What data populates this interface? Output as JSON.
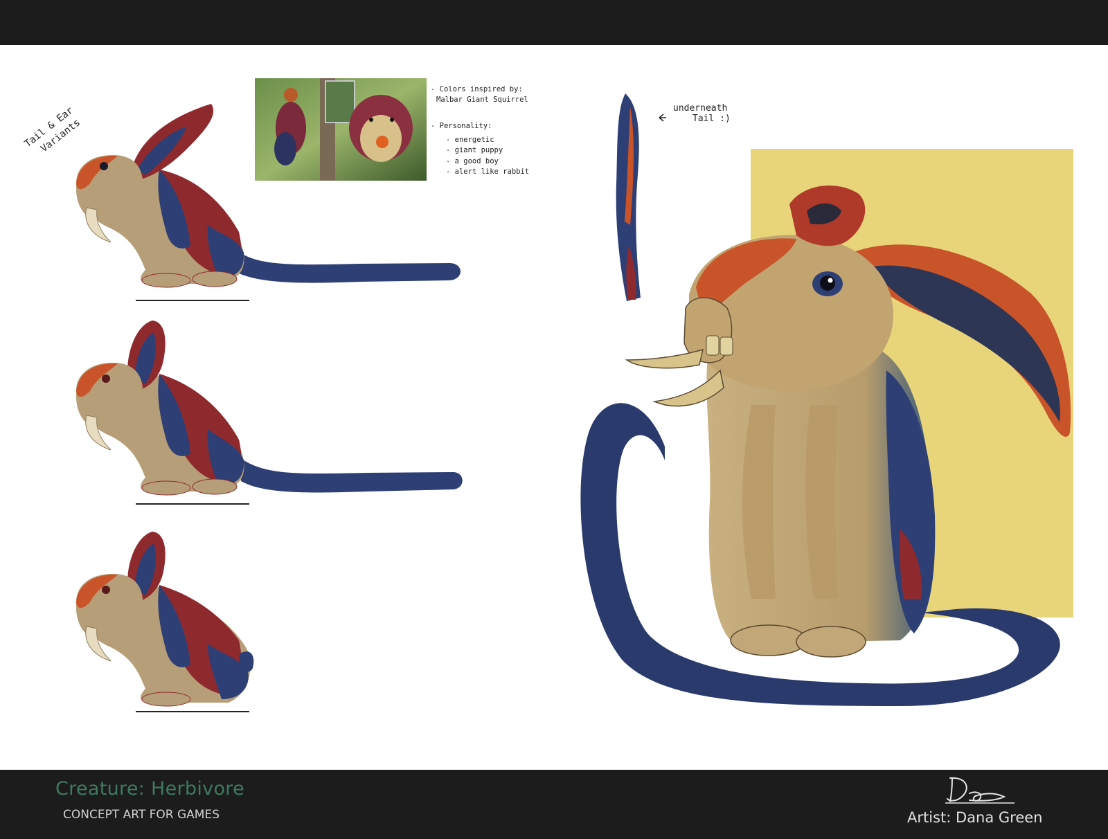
{
  "project": {
    "title": "Creature: Herbivore",
    "subtitle": "CONCEPT ART FOR GAMES",
    "artist_credit": "Artist: Dana Green",
    "signature_text": "DG"
  },
  "variants": {
    "label_line1": "Tail & Ear",
    "label_line2": "Variants"
  },
  "reference": {
    "notes": [
      "- Colors inspired by:",
      "Malbar Giant Squirrel",
      "- Personality:",
      "- energetic",
      "- giant puppy",
      "- a good boy",
      "- alert like rabbit"
    ]
  },
  "tail_detail": {
    "label_line1": "underneath",
    "label_line2": "Tail :)"
  },
  "colors": {
    "fur": "#b69f78",
    "blue": "#2d3f75",
    "red": "#8e2a2e",
    "orange": "#c9542a",
    "yellow_backdrop": "#e8d57a",
    "title_green": "#3f7a5e"
  }
}
